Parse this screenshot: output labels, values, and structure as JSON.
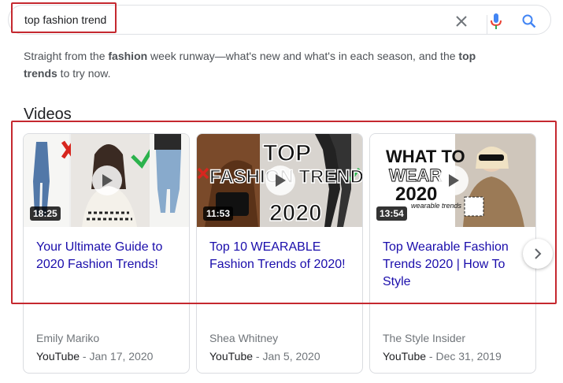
{
  "search": {
    "query": "top fashion trend",
    "clear_icon": "close-icon",
    "voice_icon": "mic-icon",
    "search_icon": "search-icon"
  },
  "snippet": {
    "part1": "Straight from the ",
    "bold1": "fashion",
    "part2": " week runway—what's new and what's in each season, and the ",
    "bold2": "top",
    "bold3": "trends",
    "part3": " to try now."
  },
  "videos": {
    "title": "Videos",
    "items": [
      {
        "title": "Your Ultimate Guide to 2020 Fashion Trends!",
        "duration": "18:25",
        "channel": "Emily Mariko",
        "source": "YouTube",
        "date": " - Jan 17, 2020"
      },
      {
        "title": "Top 10 WEARABLE Fashion Trends of 2020!",
        "duration": "11:53",
        "channel": "Shea Whitney",
        "source": "YouTube",
        "date": " - Jan 5, 2020",
        "thumb_text_top": "TOP",
        "thumb_text_mid": "FASHION TRENDS",
        "thumb_text_year": "2020"
      },
      {
        "title": "Top Wearable Fashion Trends 2020 | How To Style",
        "duration": "13:54",
        "channel": "The Style Insider",
        "source": "YouTube",
        "date": " - Dec 31, 2019",
        "thumb_text_a": "WHAT TO",
        "thumb_text_b": "WEAR",
        "thumb_text_c": "2020",
        "thumb_text_d": "wearable trends"
      }
    ],
    "next_icon": "chevron-right-icon"
  },
  "colors": {
    "link": "#1a0dab",
    "highlight": "#c5282f"
  }
}
